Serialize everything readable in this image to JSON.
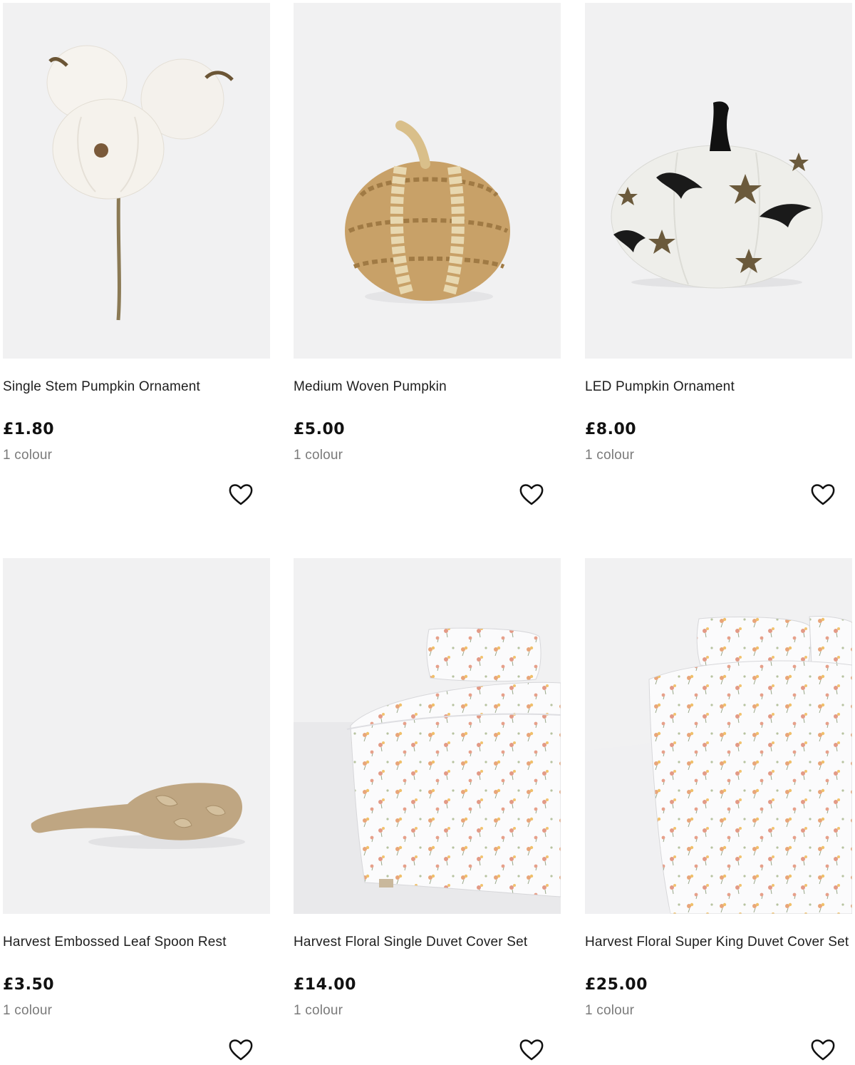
{
  "products": [
    {
      "name": "Single Stem Pumpkin Ornament",
      "price": "£1.80",
      "colours": "1 colour",
      "image": "white-pumpkin-stem-image",
      "favourite_icon": "heart-outline-icon"
    },
    {
      "name": "Medium Woven Pumpkin",
      "price": "£5.00",
      "colours": "1 colour",
      "image": "woven-pumpkin-image",
      "favourite_icon": "heart-outline-icon"
    },
    {
      "name": "LED Pumpkin Ornament",
      "price": "£8.00",
      "colours": "1 colour",
      "image": "led-pumpkin-image",
      "favourite_icon": "heart-outline-icon"
    },
    {
      "name": "Harvest Embossed Leaf Spoon Rest",
      "price": "£3.50",
      "colours": "1 colour",
      "image": "spoon-rest-image",
      "favourite_icon": "heart-outline-icon"
    },
    {
      "name": "Harvest Floral Single Duvet Cover Set",
      "price": "£14.00",
      "colours": "1 colour",
      "image": "single-duvet-image",
      "favourite_icon": "heart-outline-icon"
    },
    {
      "name": "Harvest Floral Super King Duvet Cover Set",
      "price": "£25.00",
      "colours": "1 colour",
      "image": "super-king-duvet-image",
      "favourite_icon": "heart-outline-icon"
    }
  ],
  "colors": {
    "image_background": "#f1f1f2",
    "text": "#1e1e1e",
    "muted_text": "#7a7a7a"
  }
}
